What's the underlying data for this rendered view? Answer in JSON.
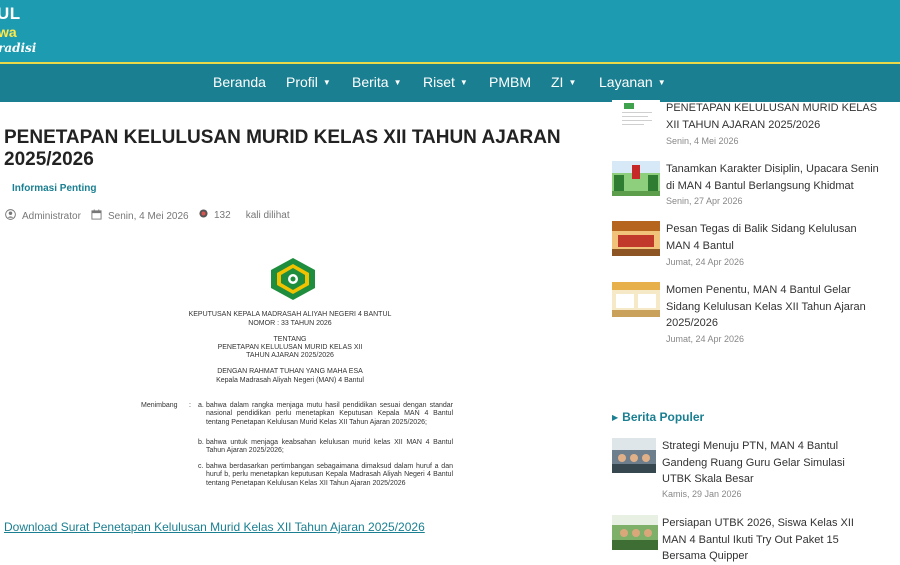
{
  "header": {
    "brand_line1": "UL",
    "brand_line2": "wa",
    "brand_line3": "radisi"
  },
  "nav": {
    "items": [
      {
        "label": "Beranda",
        "has_dropdown": false
      },
      {
        "label": "Profil",
        "has_dropdown": true
      },
      {
        "label": "Berita",
        "has_dropdown": true
      },
      {
        "label": "Riset",
        "has_dropdown": true
      },
      {
        "label": "PMBM",
        "has_dropdown": false
      },
      {
        "label": "ZI",
        "has_dropdown": true
      },
      {
        "label": "Layanan",
        "has_dropdown": true
      }
    ],
    "caret": "▼"
  },
  "article": {
    "title": "PENETAPAN KELULUSAN MURID KELAS XII TAHUN AJARAN 2025/2026",
    "category": "Informasi Penting",
    "author": "Administrator",
    "date": "Senin, 4 Mei 2026",
    "views": "132",
    "views_suffix": "kali dilihat",
    "document": {
      "heading_line1": "KEPUTUSAN KEPALA MADRASAH ALIYAH NEGERI 4 BANTUL",
      "heading_line2": "NOMOR : 33 TAHUN 2026",
      "about_line1": "TENTANG",
      "about_line2": "PENETAPAN KELULUSAN MURID KELAS XII",
      "about_line3": "TAHUN AJARAN 2025/2026",
      "grace_line1": "DENGAN RAHMAT TUHAN YANG MAHA ESA",
      "grace_line2": "Kepala Madrasah Aliyah Negeri (MAN) 4 Bantul",
      "considering_label": "Menimbang",
      "considering_colon": ":",
      "points": [
        {
          "label": "a.",
          "text": "bahwa dalam rangka menjaga mutu hasil pendidikan sesuai dengan standar nasional pendidikan perlu menetapkan Keputusan Kepala MAN 4 Bantul tentang Penetapan Kelulusan Murid Kelas XII Tahun Ajaran 2025/2026;"
        },
        {
          "label": "b.",
          "text": "bahwa untuk menjaga keabsahan kelulusan murid kelas XII MAN 4 Bantul Tahun Ajaran 2025/2026;"
        },
        {
          "label": "c.",
          "text": "bahwa berdasarkan pertimbangan sebagaimana dimaksud dalam huruf a dan huruf b, perlu menetapkan keputusan Kepala Madrasah Aliyah Negeri 4 Bantul tentang Penetapan Kelulusan Kelas XII Tahun Ajaran 2025/2026"
        }
      ]
    },
    "download_link": "Download Surat Penetapan Kelulusan Murid Kelas XII Tahun Ajaran 2025/2026"
  },
  "sidebar": {
    "recent": [
      {
        "title": "PENETAPAN KELULUSAN MURID KELAS XII TAHUN AJARAN 2025/2026",
        "date": "Senin, 4 Mei 2026"
      },
      {
        "title": "Tanamkan Karakter Disiplin, Upacara Senin di MAN 4 Bantul Berlangsung Khidmat",
        "date": "Senin, 27 Apr 2026"
      },
      {
        "title": "Pesan Tegas di Balik Sidang Kelulusan MAN 4 Bantul",
        "date": "Jumat, 24 Apr 2026"
      },
      {
        "title": "Momen Penentu, MAN 4 Bantul Gelar Sidang Kelulusan Kelas XII Tahun Ajaran 2025/2026",
        "date": "Jumat, 24 Apr 2026"
      }
    ],
    "popular_heading": "Berita Populer",
    "popular": [
      {
        "title": "Strategi Menuju PTN, MAN 4 Bantul Gandeng Ruang Guru Gelar Simulasi UTBK Skala Besar",
        "date": "Kamis, 29 Jan 2026"
      },
      {
        "title": "Persiapan UTBK 2026, Siswa Kelas XII MAN 4 Bantul Ikuti Try Out Paket 15 Bersama Quipper",
        "date": ""
      }
    ]
  },
  "colors": {
    "header": "#1d9bb0",
    "nav": "#1a7f91",
    "accent_gold": "#ffe84a",
    "link": "#1a7f91"
  },
  "icons": {
    "author": "user-circle-icon",
    "date": "calendar-icon",
    "views": "eye-icon",
    "nav_dropdown": "caret-down-icon",
    "popular_heading": "triangle-right-icon"
  }
}
